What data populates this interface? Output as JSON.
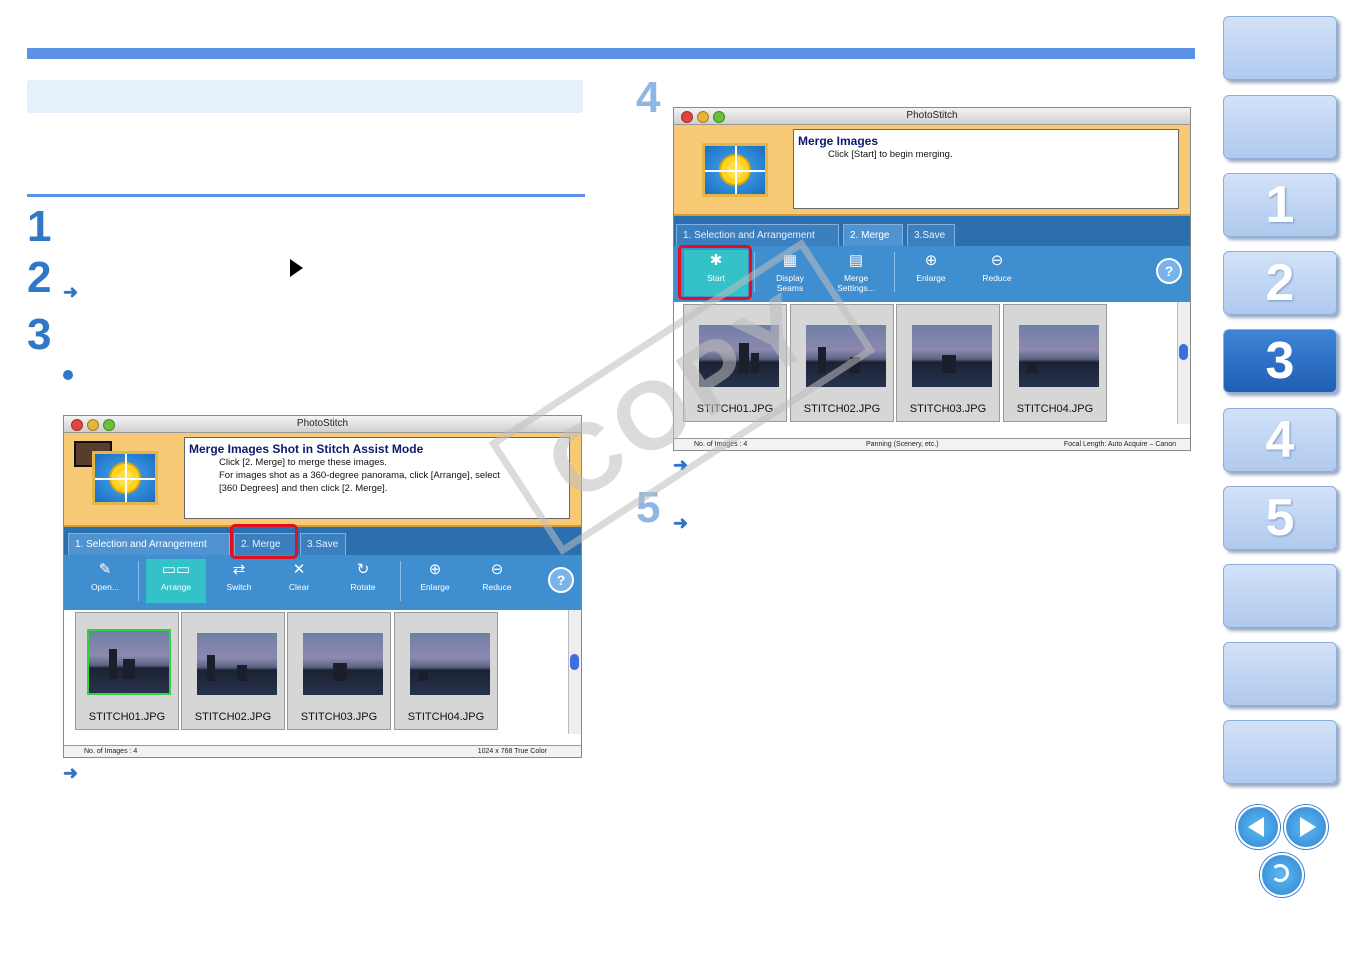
{
  "steps": {
    "s1": "1",
    "s2": "2",
    "s3": "3",
    "s4": "4",
    "s5": "5"
  },
  "arrow_glyph": "➜",
  "watermark": "COPY",
  "window_left": {
    "title": "PhotoStitch",
    "message_title": "Merge Images Shot in Stitch Assist Mode",
    "message_lines": [
      "Click [2.  Merge] to merge these images.",
      "For images shot as a 360-degree panorama, click [Arrange], select",
      "[360 Degrees] and then click [2. Merge]."
    ],
    "tabs": [
      "1. Selection and Arrangement",
      "2. Merge",
      "3.Save"
    ],
    "tools": [
      "Open...",
      "Arrange",
      "Switch",
      "Clear",
      "Rotate",
      "Enlarge",
      "Reduce"
    ],
    "help": "?",
    "thumbs": [
      "STITCH01.JPG",
      "STITCH02.JPG",
      "STITCH03.JPG",
      "STITCH04.JPG"
    ],
    "status_left": "No. of Images : 4",
    "status_right": "1024 x 768 True Color"
  },
  "window_right": {
    "title": "PhotoStitch",
    "message_title": "Merge Images",
    "message_lines": [
      "Click [Start] to begin merging."
    ],
    "tabs": [
      "1. Selection and Arrangement",
      "2. Merge",
      "3.Save"
    ],
    "tools": [
      "Start",
      "Display Seams",
      "Merge Settings...",
      "Enlarge",
      "Reduce"
    ],
    "help": "?",
    "thumbs": [
      "STITCH01.JPG",
      "STITCH02.JPG",
      "STITCH03.JPG",
      "STITCH04.JPG"
    ],
    "status_left": "No. of Images : 4",
    "status_mid": "Panning (Scenery, etc.)",
    "status_right": "Focal Length: Auto Acquire – Canon"
  },
  "nav": {
    "chapters": [
      "1",
      "2",
      "3",
      "4",
      "5"
    ],
    "active_chapter": "3"
  }
}
